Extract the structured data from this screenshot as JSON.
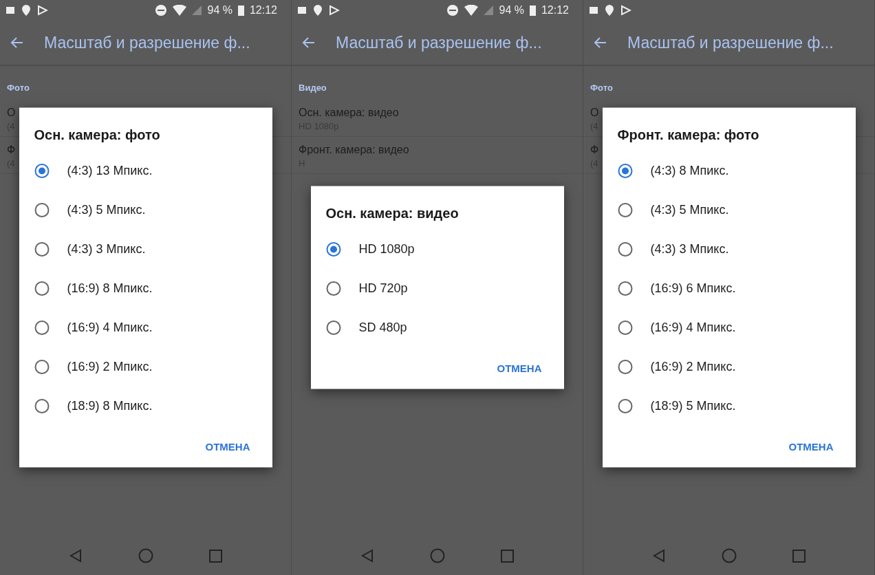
{
  "panels": [
    {
      "status_bar": {
        "battery": "94 %",
        "time": "12:12"
      },
      "header": {
        "title": "Масштаб и разрешение ф..."
      },
      "section": "Фото",
      "items": [
        {
          "title": "О",
          "subtitle": "(4"
        },
        {
          "title": "Ф",
          "subtitle": "(4"
        }
      ],
      "dialog": {
        "title": "Осн. камера: фото",
        "options": [
          {
            "label": "(4:3) 13 Мпикс.",
            "selected": true
          },
          {
            "label": "(4:3) 5 Мпикс.",
            "selected": false
          },
          {
            "label": "(4:3) 3 Мпикс.",
            "selected": false
          },
          {
            "label": "(16:9) 8 Мпикс.",
            "selected": false
          },
          {
            "label": "(16:9) 4 Мпикс.",
            "selected": false
          },
          {
            "label": "(16:9) 2 Мпикс.",
            "selected": false
          },
          {
            "label": "(18:9) 8 Мпикс.",
            "selected": false
          }
        ],
        "cancel": "ОТМЕНА"
      }
    },
    {
      "status_bar": {
        "battery": "94 %",
        "time": "12:12"
      },
      "header": {
        "title": "Масштаб и разрешение ф..."
      },
      "section": "Видео",
      "items": [
        {
          "title": "Осн. камера: видео",
          "subtitle": "HD 1080p"
        },
        {
          "title": "Фронт. камера: видео",
          "subtitle": "H"
        }
      ],
      "dialog": {
        "title": "Осн. камера: видео",
        "options": [
          {
            "label": "HD 1080p",
            "selected": true
          },
          {
            "label": "HD 720p",
            "selected": false
          },
          {
            "label": "SD 480p",
            "selected": false
          }
        ],
        "cancel": "ОТМЕНА"
      }
    },
    {
      "header": {
        "title": "Масштаб и разрешение ф..."
      },
      "section": "Фото",
      "items": [
        {
          "title": "О",
          "subtitle": "(4"
        },
        {
          "title": "Ф",
          "subtitle": "(4"
        }
      ],
      "dialog": {
        "title": "Фронт. камера: фото",
        "options": [
          {
            "label": "(4:3) 8 Мпикс.",
            "selected": true
          },
          {
            "label": "(4:3) 5 Мпикс.",
            "selected": false
          },
          {
            "label": "(4:3) 3 Мпикс.",
            "selected": false
          },
          {
            "label": "(16:9) 6 Мпикс.",
            "selected": false
          },
          {
            "label": "(16:9) 4 Мпикс.",
            "selected": false
          },
          {
            "label": "(16:9) 2 Мпикс.",
            "selected": false
          },
          {
            "label": "(18:9) 5 Мпикс.",
            "selected": false
          }
        ],
        "cancel": "ОТМЕНА"
      }
    }
  ]
}
